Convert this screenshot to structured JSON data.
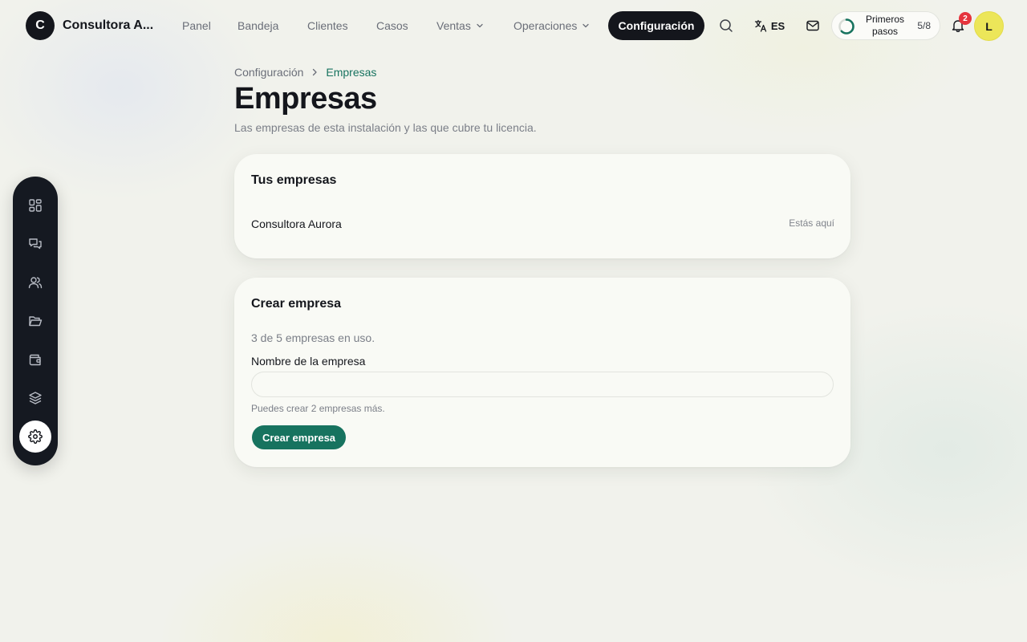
{
  "brand": {
    "logo_letter": "C",
    "name": "Consultora A..."
  },
  "nav": {
    "items": [
      {
        "label": "Panel"
      },
      {
        "label": "Bandeja"
      },
      {
        "label": "Clientes"
      },
      {
        "label": "Casos"
      },
      {
        "label": "Ventas"
      },
      {
        "label": "Operaciones"
      }
    ],
    "active": "Configuración"
  },
  "topbar": {
    "language": "ES",
    "onboarding": {
      "label": "Primeros pasos",
      "label_line1": "Primeros",
      "label_line2": "pasos",
      "count": "5/8",
      "progress": 0.625
    },
    "notifications_count": "2",
    "avatar_letter": "L"
  },
  "rail": {
    "items": [
      {
        "icon": "dashboard-icon",
        "active": false
      },
      {
        "icon": "chat-icon",
        "active": false
      },
      {
        "icon": "users-icon",
        "active": false
      },
      {
        "icon": "folder-icon",
        "active": false
      },
      {
        "icon": "wallet-icon",
        "active": false
      },
      {
        "icon": "layers-icon",
        "active": false
      },
      {
        "icon": "gear-icon",
        "active": true
      }
    ]
  },
  "breadcrumb": {
    "parent": "Configuración",
    "current": "Empresas"
  },
  "page": {
    "title": "Empresas",
    "subtitle": "Las empresas de esta instalación y las que cubre tu licencia."
  },
  "your_companies": {
    "title": "Tus empresas",
    "items": [
      {
        "name": "Consultora Aurora",
        "status": "Estás aquí"
      }
    ]
  },
  "create_company": {
    "title": "Crear empresa",
    "usage": "3 de 5 empresas en uso.",
    "field_label": "Nombre de la empresa",
    "field_value": "",
    "hint": "Puedes crear 2 empresas más.",
    "button_label": "Crear empresa"
  },
  "colors": {
    "accent": "#17735f",
    "dark": "#14161c",
    "badge": "#e5343d",
    "avatar": "#ece659"
  }
}
